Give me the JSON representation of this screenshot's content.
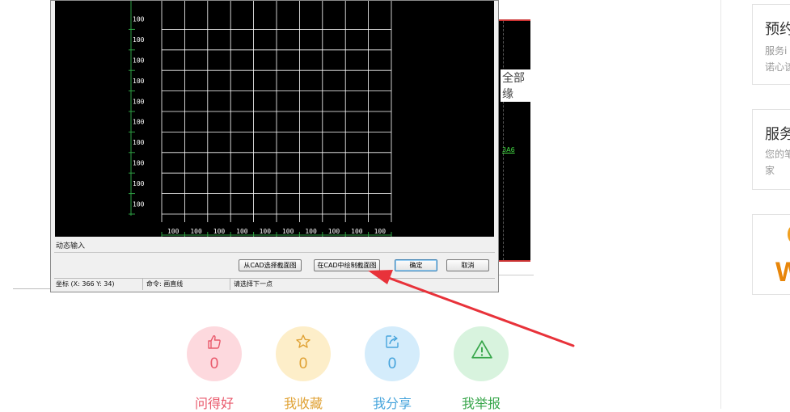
{
  "cad_dialog": {
    "grid_row_labels": [
      "100",
      "100",
      "100",
      "100",
      "100",
      "100",
      "100",
      "100",
      "100",
      "100"
    ],
    "grid_col_labels": [
      "100",
      "100",
      "100",
      "100",
      "100",
      "100",
      "100",
      "100",
      "100",
      "100"
    ],
    "dynamic_input_label": "动态输入",
    "buttons": {
      "select_from_cad": "从CAD选择截面图",
      "draw_in_cad": "在CAD中绘制截面图",
      "ok": "确定",
      "cancel": "取消"
    },
    "status": {
      "coord": "坐标 (X: 366 Y: 34)",
      "command": "命令: 画直线",
      "prompt": "请选择下一点"
    }
  },
  "background_window": {
    "text": "全部缘",
    "number": "3A6"
  },
  "actions": [
    {
      "label": "问得好",
      "count": "0",
      "icon": "thumbs-up-icon",
      "bg": "#fdd9de",
      "color": "#e95a6c"
    },
    {
      "label": "我收藏",
      "count": "0",
      "icon": "star-icon",
      "bg": "#fdeec9",
      "color": "#e0a235"
    },
    {
      "label": "我分享",
      "count": "0",
      "icon": "share-icon",
      "bg": "#d4ecfb",
      "color": "#46a4dc"
    },
    {
      "label": "我举报",
      "count": "0",
      "icon": "warning-icon",
      "bg": "#d8f3de",
      "color": "#38a64b"
    }
  ],
  "sidebar": {
    "card1": {
      "title": "预约",
      "desc1": "服务i",
      "desc2": "诺心该"
    },
    "card2": {
      "title": "服务",
      "desc1": "您的笔",
      "desc2": "家"
    },
    "card3": {
      "logo_text": "W"
    }
  },
  "colors": {
    "arrow": "#e8323a",
    "grid_line": "#ffffff",
    "axis_tick": "#2ea043"
  }
}
